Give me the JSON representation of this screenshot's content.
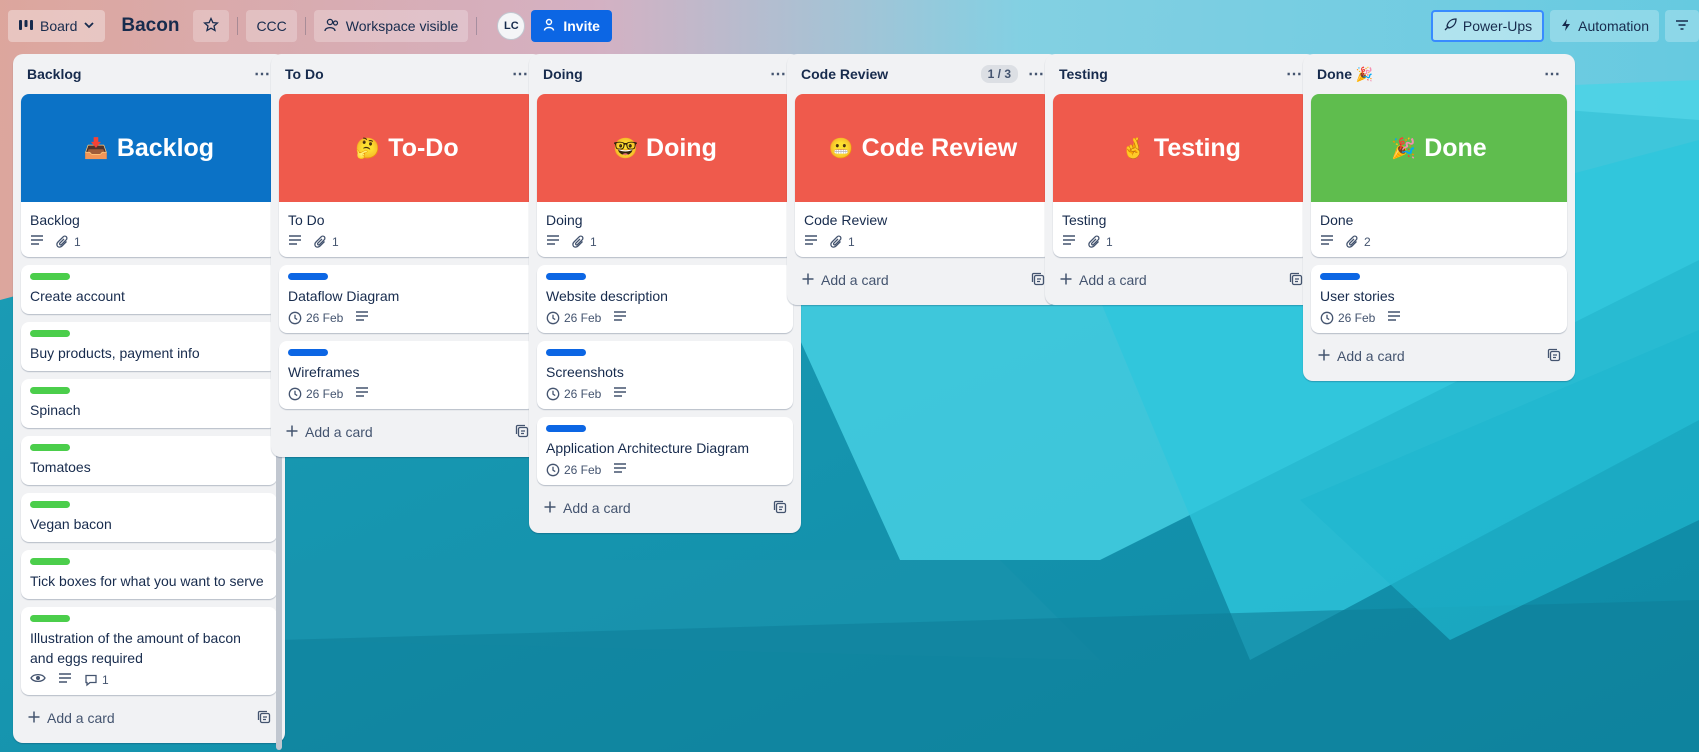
{
  "header": {
    "view_label": "Board",
    "board_title": "Bacon",
    "workspace_tag": "CCC",
    "visibility_label": "Workspace visible",
    "avatar_initials": "LC",
    "invite_label": "Invite",
    "powerups_label": "Power-Ups",
    "automation_label": "Automation"
  },
  "colors": {
    "blue": "#0b72c6",
    "red": "#ef5a4c",
    "green": "#5fbd4e",
    "label_green": "#4bce4b",
    "label_blue": "#0c66e4"
  },
  "lists": [
    {
      "title": "Backlog",
      "cover": {
        "emoji": "📥",
        "text": "Backlog",
        "color": "blue"
      },
      "cover_card": {
        "title": "Backlog",
        "attachments": "1"
      },
      "cards": [
        {
          "title": "Create account",
          "label": "green"
        },
        {
          "title": "Buy products, payment info",
          "label": "green"
        },
        {
          "title": "Spinach",
          "label": "green"
        },
        {
          "title": "Tomatoes",
          "label": "green"
        },
        {
          "title": "Vegan bacon",
          "label": "green"
        },
        {
          "title": "Tick boxes for what you want to serve",
          "label": "green"
        },
        {
          "title": "Illustration of the amount of bacon and eggs required",
          "label": "green",
          "watch": true,
          "description": true,
          "comments": "1"
        }
      ],
      "add_card": "Add a card"
    },
    {
      "title": "To Do",
      "cover": {
        "emoji": "🤔",
        "text": "To-Do",
        "color": "red"
      },
      "cover_card": {
        "title": "To Do",
        "attachments": "1"
      },
      "cards": [
        {
          "title": "Dataflow Diagram",
          "label": "blue",
          "date": "26 Feb",
          "description": true
        },
        {
          "title": "Wireframes",
          "label": "blue",
          "date": "26 Feb",
          "description": true
        }
      ],
      "add_card": "Add a card"
    },
    {
      "title": "Doing",
      "cover": {
        "emoji": "🤓",
        "text": "Doing",
        "color": "red"
      },
      "cover_card": {
        "title": "Doing",
        "attachments": "1"
      },
      "cards": [
        {
          "title": "Website description",
          "label": "blue",
          "date": "26 Feb",
          "description": true
        },
        {
          "title": "Screenshots",
          "label": "blue",
          "date": "26 Feb",
          "description": true
        },
        {
          "title": "Application Architecture Diagram",
          "label": "blue",
          "date": "26 Feb",
          "description": true
        }
      ],
      "add_card": "Add a card"
    },
    {
      "title": "Code Review",
      "count": "1 / 3",
      "cover": {
        "emoji": "😬",
        "text": "Code Review",
        "color": "red"
      },
      "cover_card": {
        "title": "Code Review",
        "attachments": "1"
      },
      "cards": [],
      "add_card": "Add a card"
    },
    {
      "title": "Testing",
      "cover": {
        "emoji": "🤞",
        "text": "Testing",
        "color": "red"
      },
      "cover_card": {
        "title": "Testing",
        "attachments": "1"
      },
      "cards": [],
      "add_card": "Add a card"
    },
    {
      "title": "Done 🎉",
      "cover": {
        "emoji": "🎉",
        "text": "Done",
        "color": "green"
      },
      "cover_card": {
        "title": "Done",
        "attachments": "2"
      },
      "cards": [
        {
          "title": "User stories",
          "label": "blue",
          "date": "26 Feb",
          "description": true
        }
      ],
      "add_card": "Add a card"
    }
  ]
}
